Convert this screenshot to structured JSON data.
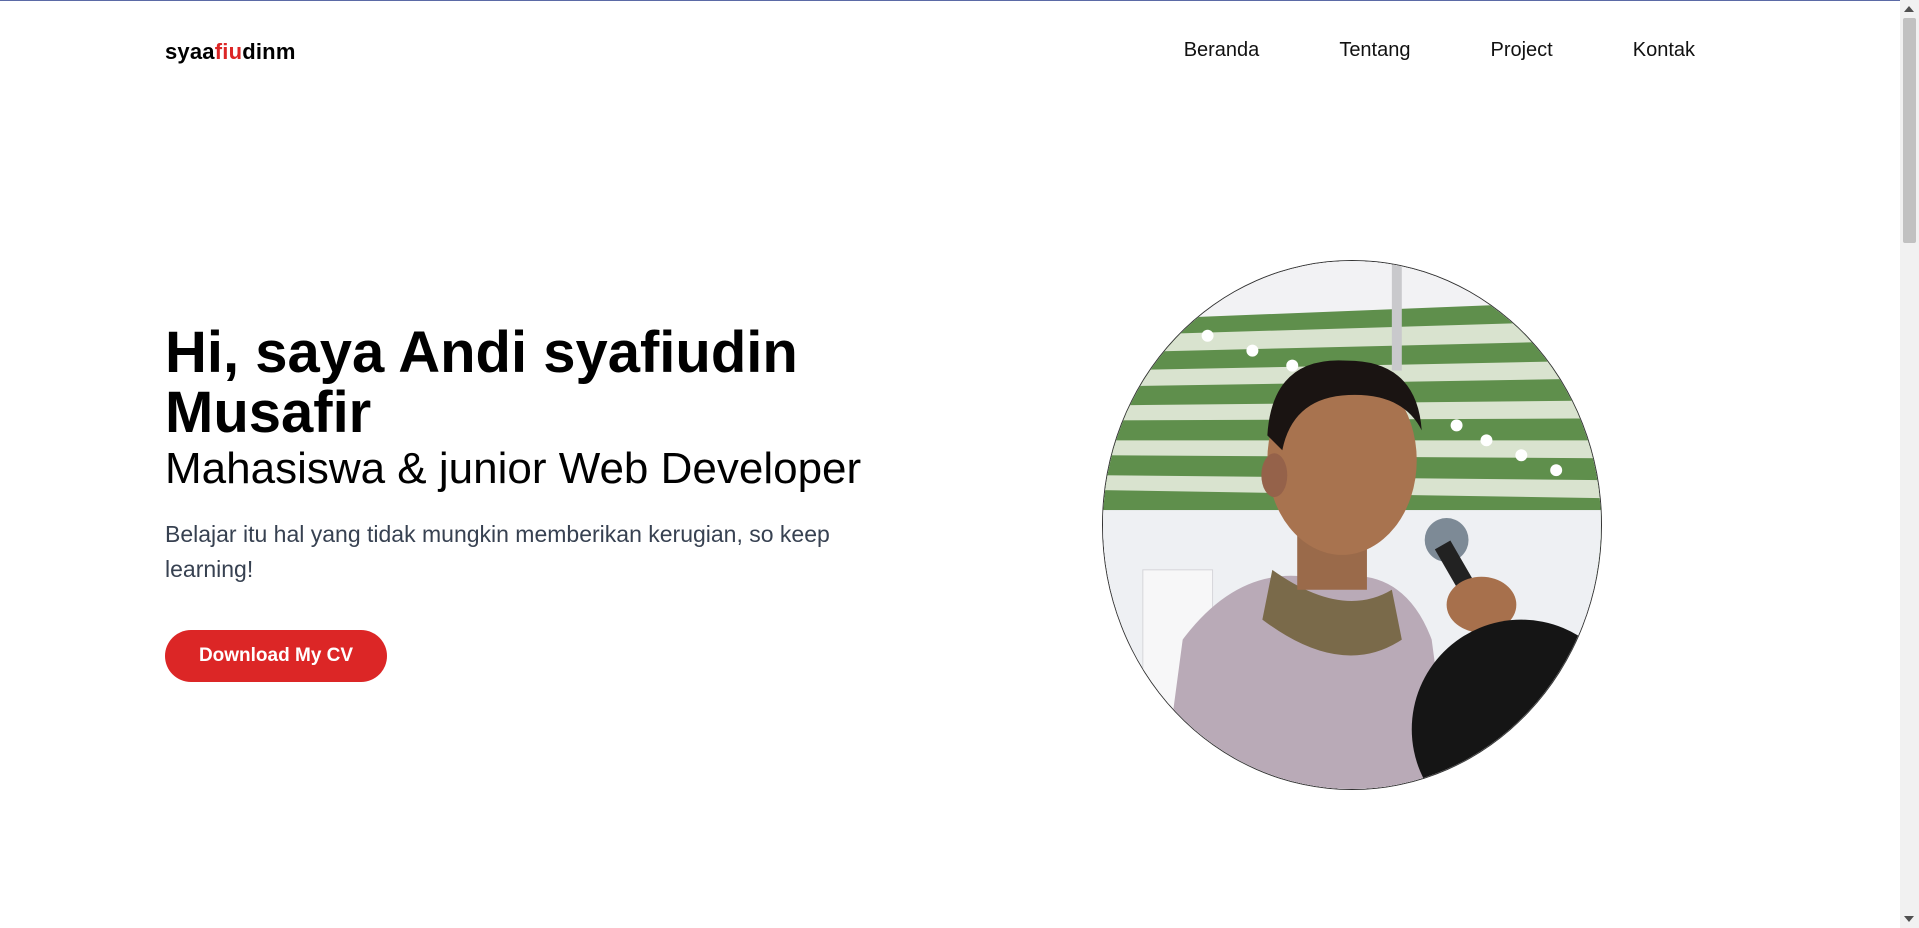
{
  "navbar": {
    "brand": {
      "part1": "syaa",
      "accent": "fiu",
      "part2": "dinm"
    },
    "links": [
      "Beranda",
      "Tentang",
      "Project",
      "Kontak"
    ]
  },
  "hero": {
    "title": "Hi, saya Andi syafiudin Musafir",
    "subtitle": "Mahasiswa & junior Web Developer",
    "tagline": "Belajar itu hal yang tidak mungkin memberikan kerugian, so keep learning!",
    "cta_label": "Download My CV"
  },
  "colors": {
    "accent": "#dc2626",
    "text": "#000000",
    "tagline": "#374151"
  },
  "icons": [
    "scroll-up-arrow-icon",
    "scroll-down-arrow-icon"
  ]
}
